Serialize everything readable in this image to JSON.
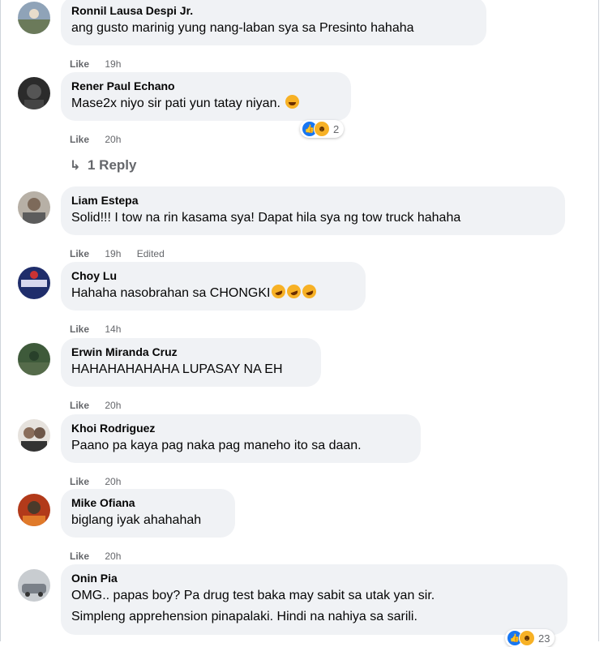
{
  "comments": [
    {
      "name": "Ronnil Lausa Despi Jr.",
      "text": "ang gusto marinig yung nang-laban sya sa Presinto hahaha",
      "like": "Like",
      "time": "19h"
    },
    {
      "name": "Rener Paul Echano",
      "text": "Mase2x niyo sir pati yun tatay niyan.",
      "like": "Like",
      "time": "20h",
      "reaction_count": "2"
    },
    {
      "name": "Liam Estepa",
      "text": "Solid!!! I tow na rin kasama sya! Dapat hila sya ng tow truck hahaha",
      "like": "Like",
      "time": "19h",
      "edited": "Edited"
    },
    {
      "name": "Choy Lu",
      "text": "Hahaha nasobrahan sa CHONGKI",
      "like": "Like",
      "time": "14h"
    },
    {
      "name": "Erwin Miranda Cruz",
      "text": "HAHAHAHAHAHA LUPASAY NA EH",
      "like": "Like",
      "time": "20h"
    },
    {
      "name": "Khoi Rodriguez",
      "text": "Paano pa kaya pag naka pag maneho ito sa daan.",
      "like": "Like",
      "time": "20h"
    },
    {
      "name": "Mike Ofiana",
      "text": "biglang iyak ahahahah",
      "like": "Like",
      "time": "20h"
    },
    {
      "name": "Onin Pia",
      "text1": "OMG.. papas boy? Pa drug test baka may sabit sa utak yan sir.",
      "text2": "Simpleng apprehension pinapalaki. Hindi na nahiya sa sarili.",
      "reaction_count": "23"
    }
  ],
  "reply_link": "1 Reply",
  "icons": {
    "reply": "reply-arrow-icon",
    "like_reaction": "like-reaction-icon",
    "haha_reaction": "haha-reaction-icon",
    "emoji": "laughing-emoji-icon"
  },
  "colors": {
    "bubble": "#f0f2f5",
    "meta": "#65676b",
    "like_blue": "#1877f2",
    "haha_yellow": "#f7b125"
  }
}
